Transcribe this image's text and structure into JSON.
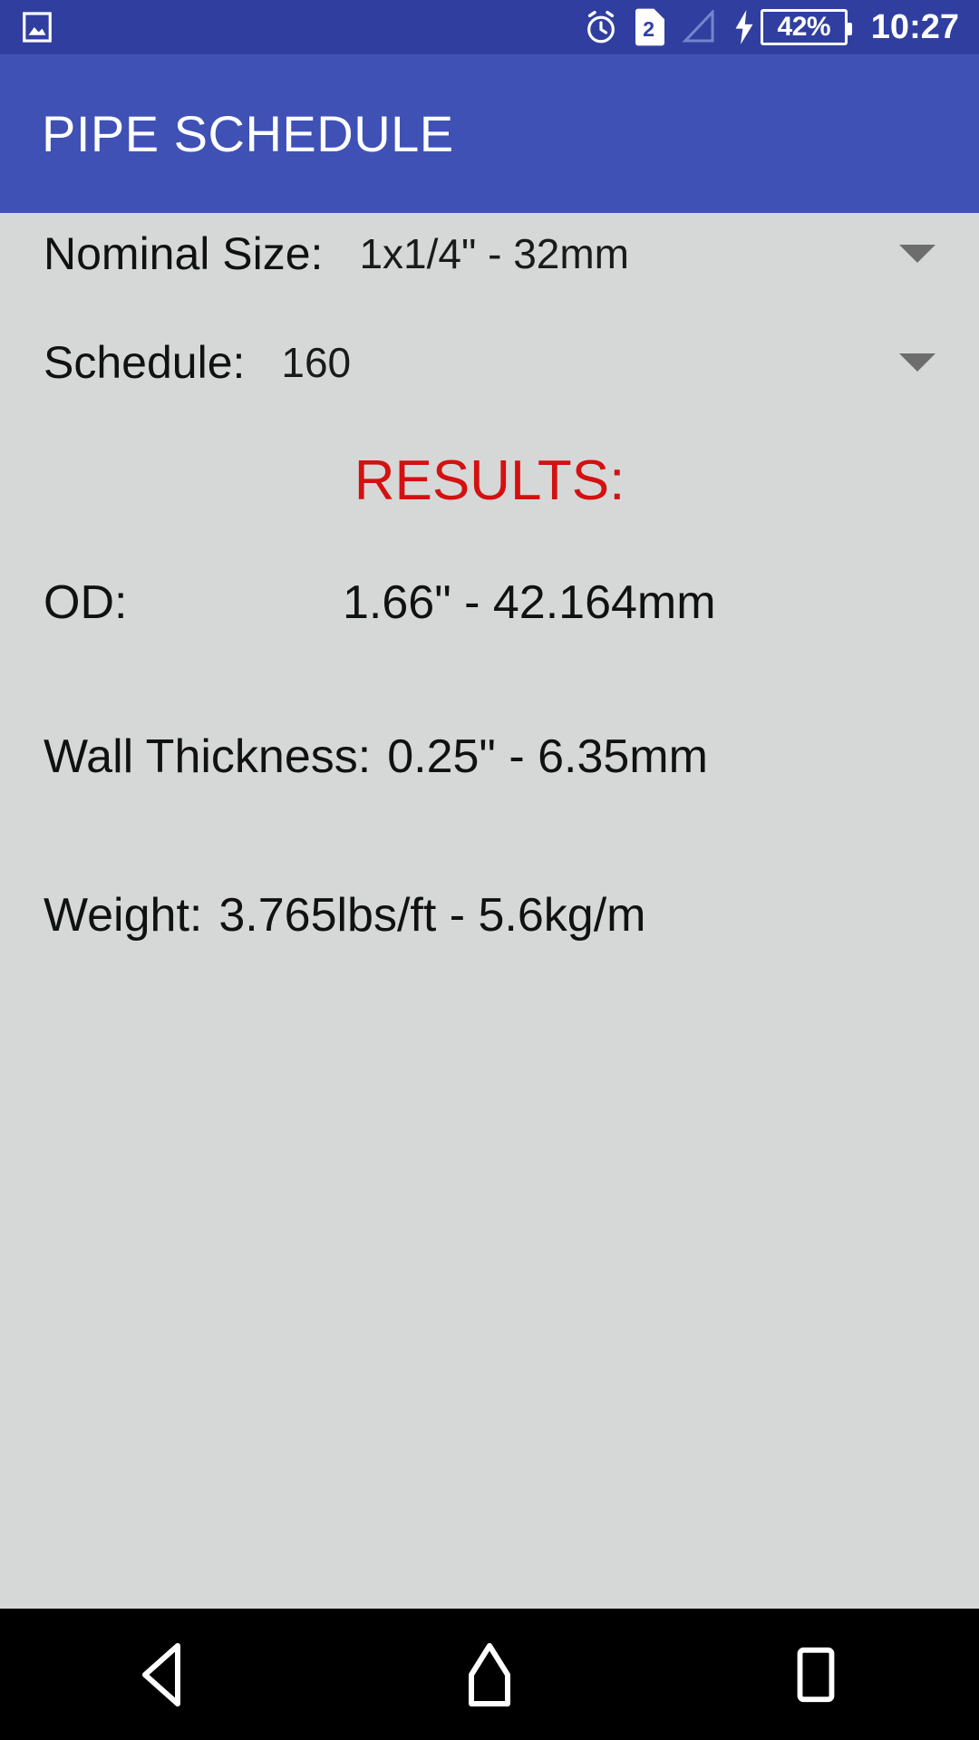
{
  "status_bar": {
    "background_color": "#303F9F",
    "icons": [
      {
        "name": "photo-notification-icon",
        "glyph": "image"
      },
      {
        "name": "alarm-clock-icon",
        "glyph": "alarm"
      },
      {
        "name": "sim-card-icon",
        "glyph": "sim",
        "label": "2"
      },
      {
        "name": "signal-strength-icon",
        "glyph": "signal-triangle"
      },
      {
        "name": "charging-bolt-icon",
        "glyph": "bolt"
      }
    ],
    "sim_label": "2",
    "battery_percent": "42%",
    "clock": "10:27"
  },
  "app_bar": {
    "title": "PIPE SCHEDULE",
    "background_color": "#3F51B5",
    "title_color": "#FFFFFF"
  },
  "form": {
    "nominal_size": {
      "label": "Nominal Size:",
      "value": "1x1/4\" - 32mm",
      "dropdown_icon": "chevron-down-icon"
    },
    "schedule": {
      "label": "Schedule:",
      "value": "160",
      "dropdown_icon": "chevron-down-icon"
    }
  },
  "results": {
    "heading": "RESULTS:",
    "heading_color": "#D41111",
    "rows": [
      {
        "label": "OD:",
        "value": "1.66\" - 42.164mm"
      },
      {
        "label": "Wall Thickness:",
        "value": "0.25\" - 6.35mm"
      },
      {
        "label": "Weight:",
        "value": "3.765lbs/ft - 5.6kg/m"
      }
    ]
  },
  "nav_bar": {
    "background_color": "#000000",
    "buttons": [
      {
        "name": "back-button",
        "icon": "back-triangle-icon"
      },
      {
        "name": "home-button",
        "icon": "home-icon"
      },
      {
        "name": "recents-button",
        "icon": "square-icon"
      }
    ]
  }
}
